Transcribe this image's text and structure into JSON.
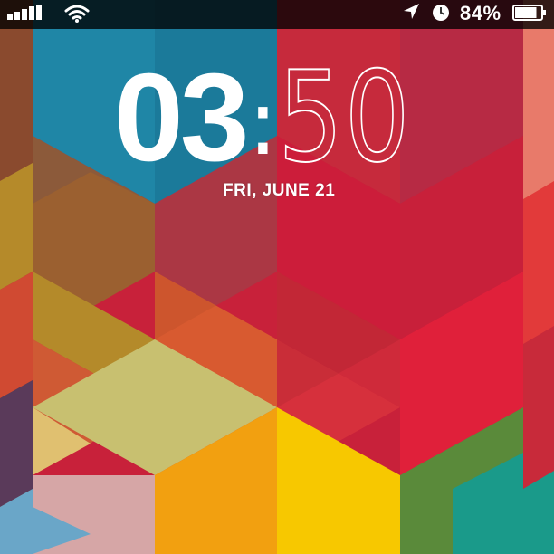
{
  "status_bar": {
    "signal_icon": "signal-bars-icon",
    "wifi_icon": "wifi-icon",
    "location_icon": "location-arrow-icon",
    "alarm_icon": "alarm-clock-icon",
    "battery_percent": "84%",
    "battery_level": 0.84,
    "battery_icon": "battery-icon"
  },
  "lock_screen": {
    "clock_hours": "03",
    "clock_separator": ":",
    "clock_minutes": "50",
    "date": "FRI, JUNE 21"
  },
  "colors": {
    "status_bar_bg": "#000000",
    "text": "#ffffff",
    "wallpaper_primary": "#c8213a"
  }
}
